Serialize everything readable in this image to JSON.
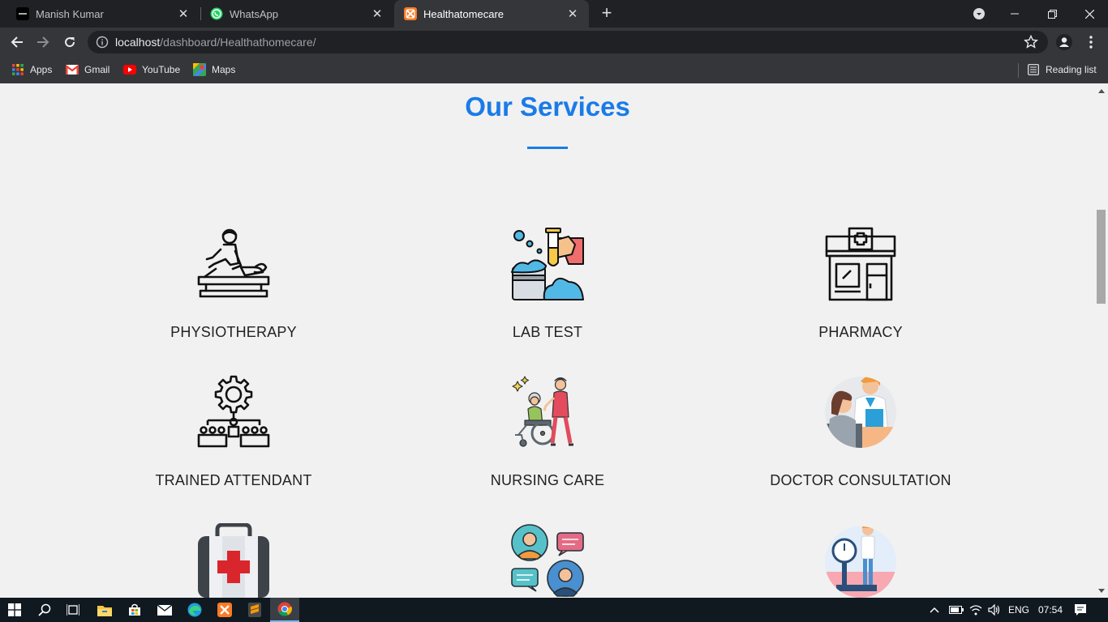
{
  "browser": {
    "tabs": [
      {
        "title": "Manish Kumar",
        "favicon": "dark-square-icon",
        "active": false
      },
      {
        "title": "WhatsApp",
        "favicon": "whatsapp-icon",
        "active": false
      },
      {
        "title": "Healthatomecare",
        "favicon": "xampp-icon",
        "active": true
      }
    ],
    "address": {
      "host": "localhost",
      "path": "/dashboard/Healthathomecare/"
    },
    "bookmarks": [
      {
        "label": "Apps",
        "icon": "apps-grid-icon"
      },
      {
        "label": "Gmail",
        "icon": "gmail-icon"
      },
      {
        "label": "YouTube",
        "icon": "youtube-icon"
      },
      {
        "label": "Maps",
        "icon": "maps-icon"
      }
    ],
    "reading_list": "Reading list"
  },
  "page": {
    "heading": "Our Services",
    "accent_color": "#1a7be8",
    "services": [
      {
        "label": "PHYSIOTHERAPY",
        "icon": "physiotherapy-icon"
      },
      {
        "label": "LAB TEST",
        "icon": "lab-test-icon"
      },
      {
        "label": "PHARMACY",
        "icon": "pharmacy-icon"
      },
      {
        "label": "TRAINED ATTENDANT",
        "icon": "trained-attendant-icon"
      },
      {
        "label": "NURSING CARE",
        "icon": "nursing-care-icon"
      },
      {
        "label": "DOCTOR CONSULTATION",
        "icon": "doctor-consultation-icon"
      },
      {
        "label": "",
        "icon": "first-aid-kit-icon"
      },
      {
        "label": "",
        "icon": "chat-consult-icon"
      },
      {
        "label": "",
        "icon": "weight-scale-icon"
      }
    ]
  },
  "taskbar": {
    "apps": [
      "start-icon",
      "search-icon",
      "task-view-icon",
      "file-explorer-icon",
      "store-icon",
      "mail-icon",
      "edge-icon",
      "xampp-icon",
      "sublime-icon",
      "chrome-icon"
    ],
    "language": "ENG",
    "time": "07:54"
  }
}
